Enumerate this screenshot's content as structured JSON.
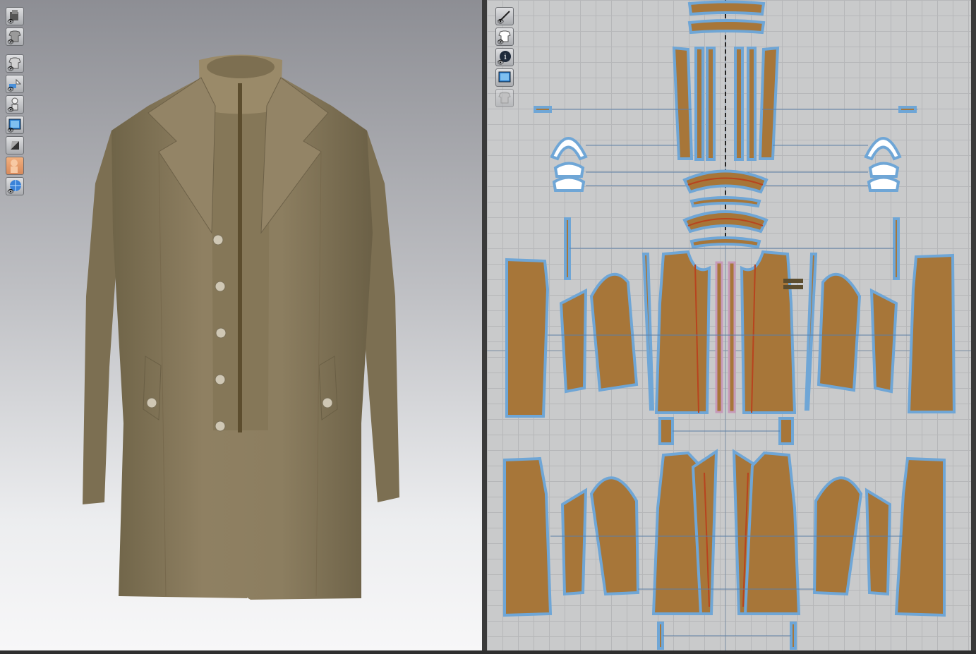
{
  "window": {
    "layout": "3D garment view | 2D pattern view"
  },
  "toolbar_3d": [
    {
      "icon": "avatar-display-icon"
    },
    {
      "icon": "garment-display-icon"
    },
    {
      "icon": "show-garment-icon"
    },
    {
      "icon": "show-pins-icon"
    },
    {
      "icon": "show-avatar-icon"
    },
    {
      "icon": "texture-view-icon"
    },
    {
      "icon": "shaded-view-icon"
    },
    {
      "icon": "avatar-skin-icon"
    },
    {
      "icon": "environment-icon"
    }
  ],
  "toolbar_2d": [
    {
      "icon": "sewing-line-icon"
    },
    {
      "icon": "show-garment-2d-icon"
    },
    {
      "icon": "info-icon"
    },
    {
      "icon": "texture-2d-icon"
    },
    {
      "icon": "lock-garment-icon"
    }
  ],
  "colors": {
    "fabric_3d": "#8b7c5e",
    "pattern_fill": "#a77639",
    "pattern_outline": "#6fa6d6",
    "seam_red": "#b8431e",
    "grid": "#b6b7b9"
  }
}
